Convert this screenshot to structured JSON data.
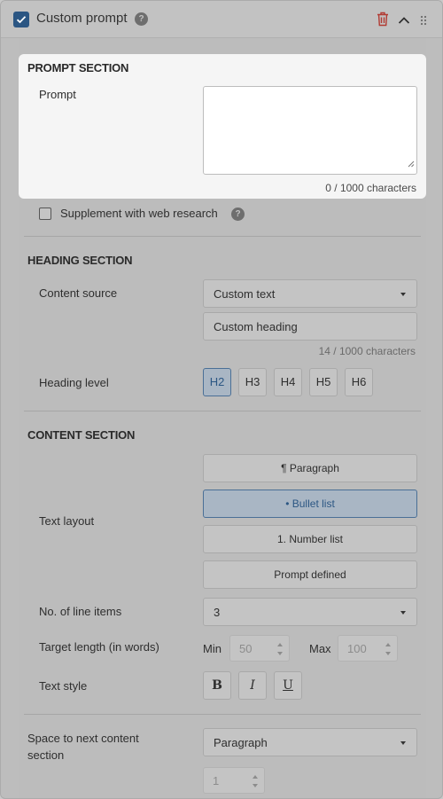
{
  "header": {
    "title": "Custom prompt",
    "help_glyph": "?",
    "checked": true,
    "icons": [
      "checkbox-checked-icon",
      "help-icon",
      "trash-icon",
      "chevron-up-icon",
      "drag-handle-icon"
    ]
  },
  "prompt_section": {
    "title": "PROMPT SECTION",
    "prompt_label": "Prompt",
    "prompt_value": "",
    "char_count": "0 / 1000 characters"
  },
  "web_research": {
    "label": "Supplement with web research",
    "checked": false,
    "help_glyph": "?"
  },
  "heading_section": {
    "title": "HEADING SECTION",
    "content_source_label": "Content source",
    "content_source_value": "Custom text",
    "heading_value": "Custom heading",
    "char_count": "14 / 1000 characters",
    "heading_level_label": "Heading level",
    "levels": [
      "H2",
      "H3",
      "H4",
      "H5",
      "H6"
    ],
    "selected_level": "H2"
  },
  "content_section": {
    "title": "CONTENT SECTION",
    "text_layout_label": "Text layout",
    "layouts": [
      "¶ Paragraph",
      "• Bullet list",
      "1. Number list",
      "Prompt defined"
    ],
    "selected_layout": "• Bullet list",
    "line_items_label": "No. of line items",
    "line_items_value": "3",
    "target_length_label": "Target length (in words)",
    "min_label": "Min",
    "min_value": "50",
    "max_label": "Max",
    "max_value": "100",
    "text_style_label": "Text style",
    "styles": [
      "B",
      "I",
      "U"
    ]
  },
  "spacing": {
    "label": "Space to next content section",
    "value": "Paragraph",
    "count_value": "1"
  },
  "colors": {
    "accent": "#2b5683",
    "highlight_bg": "#f5f5f5",
    "overlay_bg": "#bcbcbc",
    "trash": "#c0392b"
  }
}
